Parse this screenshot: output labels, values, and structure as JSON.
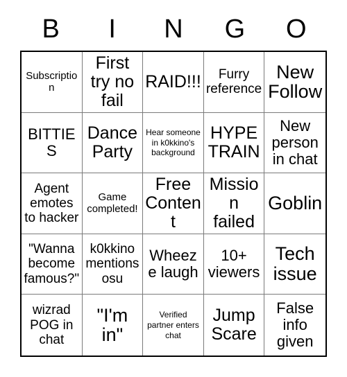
{
  "card": {
    "header_letters": [
      "B",
      "I",
      "N",
      "G",
      "O"
    ],
    "cells": [
      {
        "text": "Subscription",
        "size": "sm"
      },
      {
        "text": "First try no fail",
        "size": "xl"
      },
      {
        "text": "RAID!!!",
        "size": "xl"
      },
      {
        "text": "Furry reference",
        "size": "md"
      },
      {
        "text": "New Follow",
        "size": "xxl"
      },
      {
        "text": "BITTIES",
        "size": "lg"
      },
      {
        "text": "Dance Party",
        "size": "xl"
      },
      {
        "text": "Hear someone in k0kkino's background",
        "size": "xs"
      },
      {
        "text": "HYPE TRAIN",
        "size": "xl"
      },
      {
        "text": "New person in chat",
        "size": "lg"
      },
      {
        "text": "Agent emotes to hacker",
        "size": "md"
      },
      {
        "text": "Game completed!",
        "size": "sm"
      },
      {
        "text": "Free Content",
        "size": "xl"
      },
      {
        "text": "Mission failed",
        "size": "xl"
      },
      {
        "text": "Goblin",
        "size": "xxl"
      },
      {
        "text": "\"Wanna become famous?\"",
        "size": "md"
      },
      {
        "text": "k0kkino mentions osu",
        "size": "md"
      },
      {
        "text": "Wheeze laugh",
        "size": "lg"
      },
      {
        "text": "10+ viewers",
        "size": "lg"
      },
      {
        "text": "Tech issue",
        "size": "xxl"
      },
      {
        "text": "wizrad POG in chat",
        "size": "md"
      },
      {
        "text": "\"I'm in\"",
        "size": "xxl"
      },
      {
        "text": "Verified partner enters chat",
        "size": "xs"
      },
      {
        "text": "Jump Scare",
        "size": "xl"
      },
      {
        "text": "False info given",
        "size": "lg"
      }
    ]
  }
}
